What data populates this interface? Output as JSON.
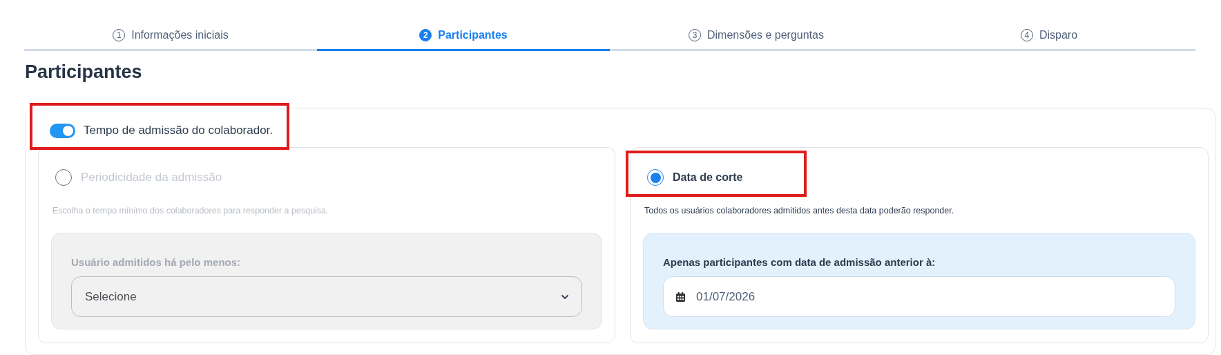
{
  "steps": [
    {
      "number": "1",
      "label": "Informações iniciais",
      "selected": false
    },
    {
      "number": "2",
      "label": "Participantes",
      "selected": true
    },
    {
      "number": "3",
      "label": "Dimensões e perguntas",
      "selected": false
    },
    {
      "number": "4",
      "label": "Disparo",
      "selected": false
    }
  ],
  "heading": "Participantes",
  "toggle": {
    "label": "Tempo de admissão do colaborador.",
    "on": true,
    "highlighted": true
  },
  "options": [
    {
      "kind": "select",
      "label": "Periodicidade da admissão",
      "selected": false,
      "disabled": true,
      "highlighted": false,
      "hint": "Escolha o tempo mínimo dos colaboradores para responder a pesquisa.",
      "field_label": "Usuário admitidos há pelo menos:",
      "placeholder": "Selecione"
    },
    {
      "kind": "date",
      "label": "Data de corte",
      "selected": true,
      "disabled": false,
      "highlighted": true,
      "hint": "Todos os usuários colaboradores admitidos antes desta data poderão responder.",
      "field_label": "Apenas participantes com data de admissão anterior à:",
      "value": "01/07/2026"
    }
  ]
}
